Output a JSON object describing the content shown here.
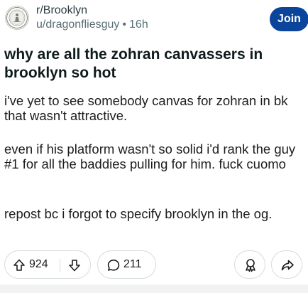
{
  "header": {
    "subreddit": "r/Brooklyn",
    "author": "u/dragonfliesguy",
    "separator": "•",
    "time_ago": "16h",
    "join_label": "Join",
    "avatar_icon": "brooklyn-borough-seal-icon"
  },
  "post": {
    "title": "why are all the zohran canvassers in brooklyn so hot",
    "paragraphs": [
      "i've yet to see somebody canvas for zohran in bk that wasn't attractive.",
      "even if his platform wasn't so solid i'd rank the guy #1 for all the baddies pulling for him. fuck cuomo",
      "repost bc i forgot to specify brooklyn in the og."
    ]
  },
  "actions": {
    "upvote_icon": "upvote-arrow-icon",
    "score": "924",
    "downvote_icon": "downvote-arrow-icon",
    "comment_icon": "comment-bubble-icon",
    "comments": "211",
    "award_icon": "award-icon",
    "share_icon": "share-arrow-icon"
  },
  "colors": {
    "join_button": "#0a449b",
    "text": "#0f1a1c",
    "meta": "#576f76",
    "border": "#d6dcde"
  }
}
